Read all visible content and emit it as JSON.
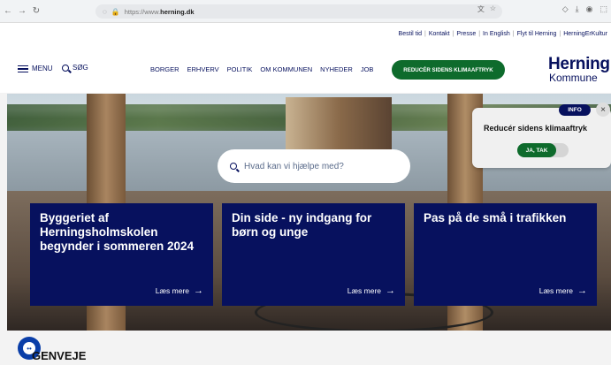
{
  "browser": {
    "url_prefix": "https://www.",
    "url_host": "herning.dk"
  },
  "util_nav": [
    "Bestil tid",
    "Kontakt",
    "Presse",
    "In English",
    "Flyt til Herning",
    "HerningErKultur"
  ],
  "header": {
    "menu_label": "MENU",
    "search_label": "SØG",
    "nav": [
      "BORGER",
      "ERHVERV",
      "POLITIK",
      "OM KOMMUNEN",
      "NYHEDER",
      "JOB"
    ],
    "climate_button": "REDUCÉR SIDENS KLIMAAFTRYK",
    "logo_line1": "Herning",
    "logo_line2": "Kommune"
  },
  "hero": {
    "search_placeholder": "Hvad kan vi hjælpe med?"
  },
  "cards": [
    {
      "title": "Byggeriet af Herningsholmskolen begynder i sommeren 2024",
      "more": "Læs mere"
    },
    {
      "title": "Din side - ny indgang for børn og unge",
      "more": "Læs mere"
    },
    {
      "title": "Pas på de små i trafikken",
      "more": "Læs mere"
    }
  ],
  "popup": {
    "badge": "INFO",
    "title": "Reducér sidens klimaaftryk",
    "toggle_label": "JA, TAK"
  },
  "section_title": "GENVEJE",
  "colors": {
    "navy": "#07115e",
    "green": "#0e6b2c"
  }
}
